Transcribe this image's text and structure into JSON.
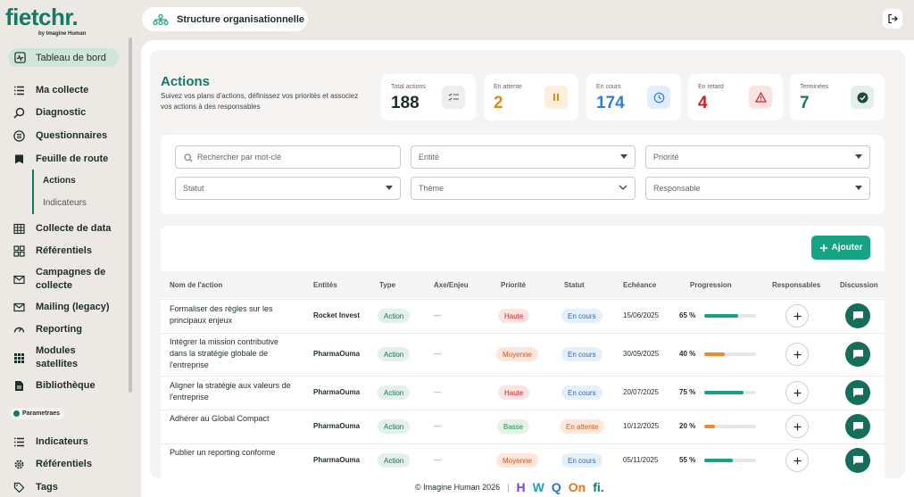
{
  "app": {
    "logo_text": "fietchr.",
    "logo_by": "by Imagine Human",
    "top_title": "Structure organisationnelle"
  },
  "sidebar": {
    "dashboard": "Tableau de bord",
    "items": [
      {
        "label": "Ma collecte",
        "icon": "list-icon"
      },
      {
        "label": "Diagnostic",
        "icon": "magnifier-icon"
      },
      {
        "label": "Questionnaires",
        "icon": "list-circle-icon"
      },
      {
        "label": "Feuille de route",
        "icon": "bucket-icon"
      },
      {
        "label": "Collecte de data",
        "icon": "table-icon"
      },
      {
        "label": "Référentiels",
        "icon": "grid-icon"
      },
      {
        "label": "Campagnes de collecte",
        "icon": "mail-icon"
      },
      {
        "label": "Mailing (legacy)",
        "icon": "mail-icon"
      },
      {
        "label": "Reporting",
        "icon": "gauge-icon"
      },
      {
        "label": "Modules satellites",
        "icon": "apps-icon"
      },
      {
        "label": "Bibliothèque",
        "icon": "document-icon"
      }
    ],
    "sub_items": [
      "Actions",
      "Indicateurs"
    ],
    "params_badge": "Parametraes",
    "params_items": [
      {
        "label": "Indicateurs",
        "icon": "list-icon"
      },
      {
        "label": "Référentiels",
        "icon": "gear-icon"
      },
      {
        "label": "Tags",
        "icon": "tag-icon"
      }
    ]
  },
  "header": {
    "title": "Actions",
    "description": "Suivez vos plans d'actions, définissez vos priorités et associez vos actions à des responsables"
  },
  "stats": [
    {
      "label": "Total actions",
      "value": "188",
      "color": "#1f2d2a",
      "icon": "checklist-icon",
      "icon_bg": "#eeeeee"
    },
    {
      "label": "En attente",
      "value": "2",
      "color": "#e0891a",
      "icon": "pause-icon",
      "icon_bg": "#fdefdc"
    },
    {
      "label": "En cours",
      "value": "174",
      "color": "#2f7fd8",
      "icon": "clock-icon",
      "icon_bg": "#e2eefb"
    },
    {
      "label": "En retard",
      "value": "4",
      "color": "#c82323",
      "icon": "warning-icon",
      "icon_bg": "#fbe3e3"
    },
    {
      "label": "Terminées",
      "value": "7",
      "color": "#127a66",
      "icon": "check-circle-icon",
      "icon_bg": "#e4efec"
    }
  ],
  "filters": {
    "search_placeholder": "Rechercher par mot-clé",
    "entity": "Entité",
    "priority": "Priorité",
    "status": "Statut",
    "theme": "Thème",
    "owner": "Responsable"
  },
  "table": {
    "add_label": "Ajouter",
    "columns": [
      "Nom de l'action",
      "Entités",
      "Type",
      "Axe/Enjeu",
      "Priorité",
      "Statut",
      "Echéance",
      "Progression",
      "Responsables",
      "Discussion"
    ],
    "rows": [
      {
        "name": "Formaliser des règles sur les principaux enjeux",
        "entity": "Rocket Invest",
        "type": "Action",
        "axis": "—",
        "priority": "Haute",
        "status": "En cours",
        "due": "15/06/2025",
        "progress": 65,
        "progress_label": "65 %"
      },
      {
        "name": "Intégrer la mission contributive dans la stratégie globale de l'entreprise",
        "entity": "PharmaOuma",
        "type": "Action",
        "axis": "—",
        "priority": "Moyenne",
        "status": "En cours",
        "due": "30/09/2025",
        "progress": 40,
        "progress_label": "40 %"
      },
      {
        "name": "Aligner la stratégie aux valeurs de l'entreprise",
        "entity": "PharmaOuma",
        "type": "Action",
        "axis": "—",
        "priority": "Haute",
        "status": "En cours",
        "due": "20/07/2025",
        "progress": 75,
        "progress_label": "75 %"
      },
      {
        "name": "Adhérer au Global Compact",
        "entity": "PharmaOuma",
        "type": "Action",
        "axis": "—",
        "priority": "Basse",
        "status": "En attente",
        "due": "10/12/2025",
        "progress": 20,
        "progress_label": "20 %"
      },
      {
        "name": "Publier un reporting conforme",
        "entity": "PharmaOuma",
        "type": "Action",
        "axis": "—",
        "priority": "Moyenne",
        "status": "En cours",
        "due": "05/11/2025",
        "progress": 55,
        "progress_label": "55 %"
      }
    ]
  },
  "footer": {
    "copyright": "© Imagine Human 2026",
    "brands": [
      "H",
      "W",
      "Q",
      "On",
      "fi."
    ]
  },
  "colors": {
    "accent": "#127a66",
    "progress_green": "#17a283",
    "progress_orange": "#f08a24"
  }
}
